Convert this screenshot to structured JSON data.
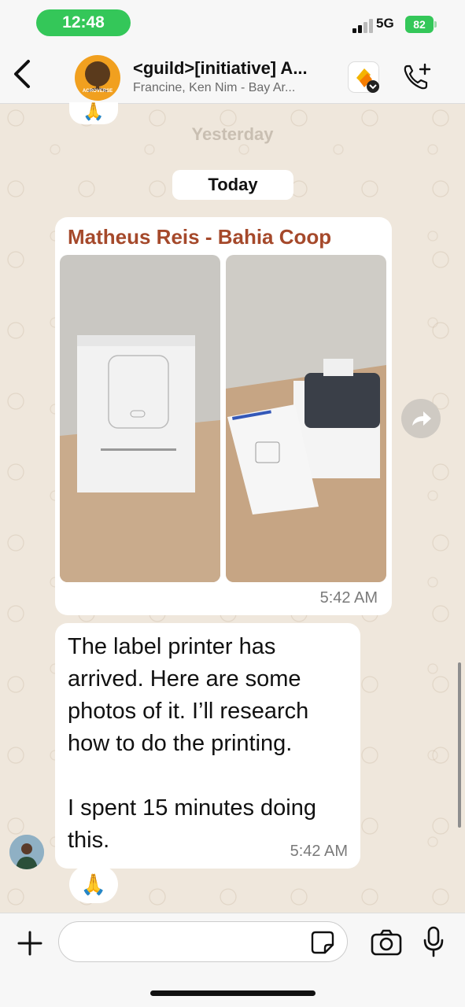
{
  "status": {
    "time": "12:48",
    "network": "5G",
    "battery": "82"
  },
  "header": {
    "title": "<guild>[initiative] A...",
    "subtitle": "Francine, Ken Nim - Bay Ar...",
    "group_logo_text": "AGROVERSE"
  },
  "chat": {
    "yesterday_label": "Yesterday",
    "today_label": "Today",
    "top_reaction": "🙏",
    "image_message": {
      "sender": "Matheus Reis - Bahia Coop",
      "time": "5:42 AM"
    },
    "text_message": {
      "text": "The label printer has arrived. Here are some photos of it. I’ll research how to do the printing.\n\nI spent 15 minutes doing this.",
      "time": "5:42 AM",
      "reaction": "🙏"
    }
  },
  "composer": {
    "placeholder": ""
  },
  "colors": {
    "sender": "#a5492b",
    "accent": "#34c759",
    "wallpaper": "#efe7dc"
  }
}
